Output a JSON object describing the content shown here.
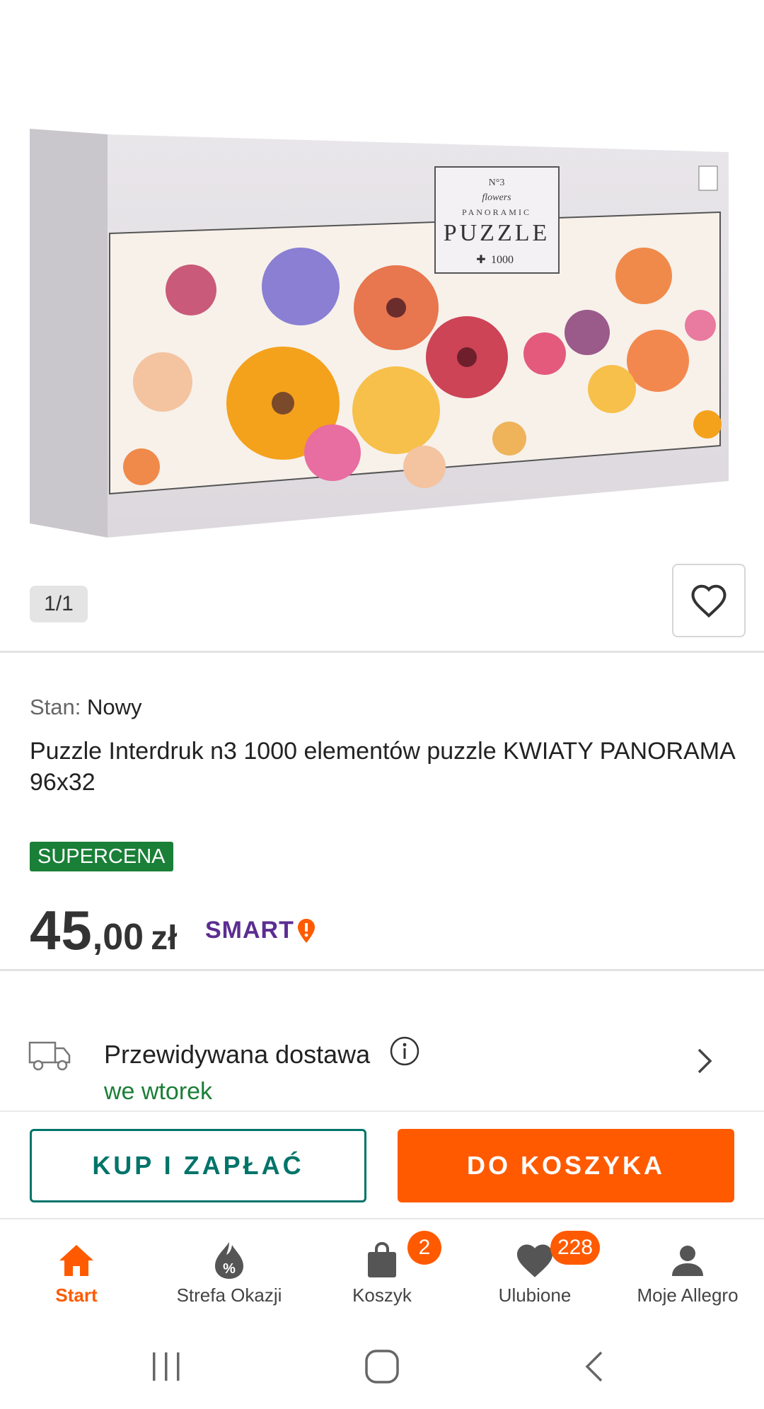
{
  "gallery": {
    "counter": "1/1",
    "product_image": {
      "box_number": "N°3",
      "box_subtitle": "flowers",
      "box_series": "PANORAMIC",
      "box_title": "PUZZLE",
      "box_pieces": "1000"
    }
  },
  "product": {
    "condition_label": "Stan:",
    "condition_value": "Nowy",
    "title": "Puzzle Interdruk n3 1000 elementów puzzle KWIATY PANORAMA 96x32",
    "badge": "SUPERCENA",
    "price_int": "45",
    "price_dec": ",00",
    "currency": "zł",
    "smart_label": "SMART"
  },
  "delivery": {
    "label": "Przewidywana dostawa",
    "day": "we wtorek"
  },
  "actions": {
    "buy_now": "KUP I ZAPŁAĆ",
    "add_to_cart": "DO KOSZYKA"
  },
  "bottom_nav": {
    "start": "Start",
    "deals": "Strefa Okazji",
    "cart": "Koszyk",
    "cart_count": "2",
    "favorites": "Ulubione",
    "favorites_count": "228",
    "account": "Moje Allegro"
  },
  "colors": {
    "accent": "#ff5a00",
    "teal": "#00746a",
    "green": "#1a7f37",
    "smart": "#5c2d91"
  }
}
